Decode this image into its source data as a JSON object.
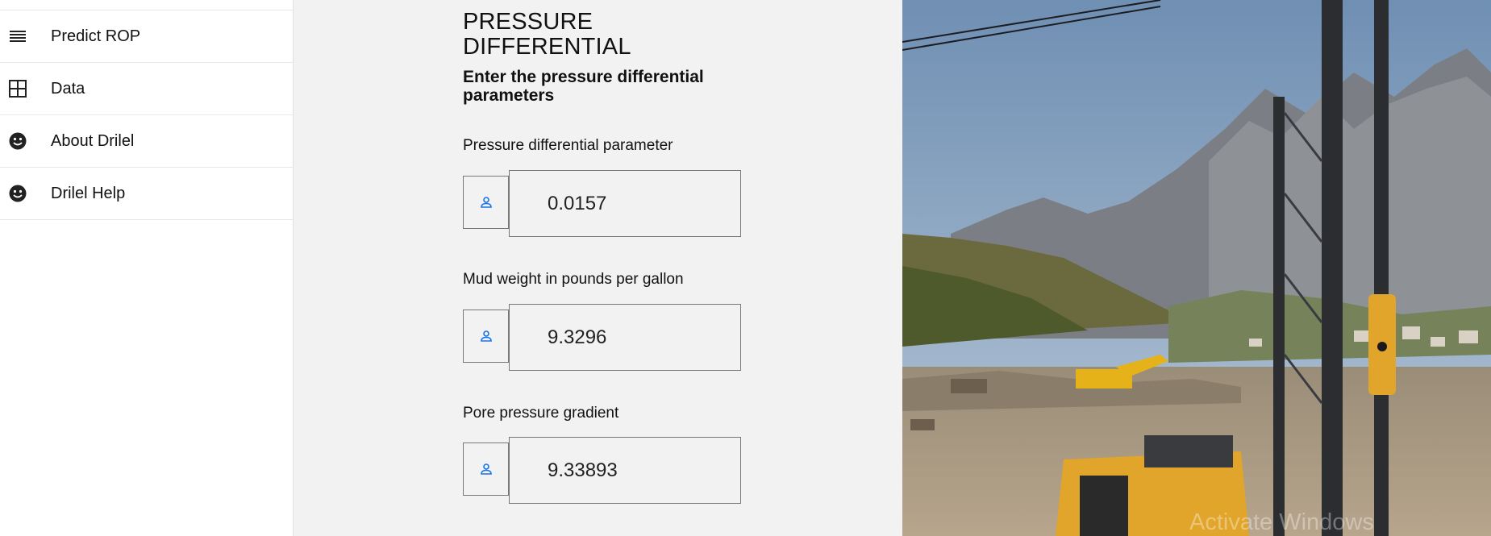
{
  "sidebar": {
    "items": [
      {
        "label": "Predict ROP",
        "icon": "menu-lines-icon"
      },
      {
        "label": "Data",
        "icon": "grid-icon"
      },
      {
        "label": "About Drilel",
        "icon": "smiley-icon"
      },
      {
        "label": "Drilel Help",
        "icon": "smiley-icon"
      }
    ]
  },
  "form": {
    "title": "PRESSURE DIFFERENTIAL",
    "subtitle": "Enter the pressure differential parameters",
    "fields": [
      {
        "label": "Pressure differential parameter",
        "value": "0.0157",
        "icon": "person-icon"
      },
      {
        "label": "Mud weight in pounds per gallon",
        "value": "9.3296",
        "icon": "person-icon"
      },
      {
        "label": "Pore pressure gradient",
        "value": "9.33893",
        "icon": "person-icon"
      }
    ]
  },
  "watermark": "Activate Windows",
  "colors": {
    "icon_accent": "#1a73e8",
    "sidebar_bg": "#ffffff",
    "main_bg": "#f2f2f2"
  }
}
